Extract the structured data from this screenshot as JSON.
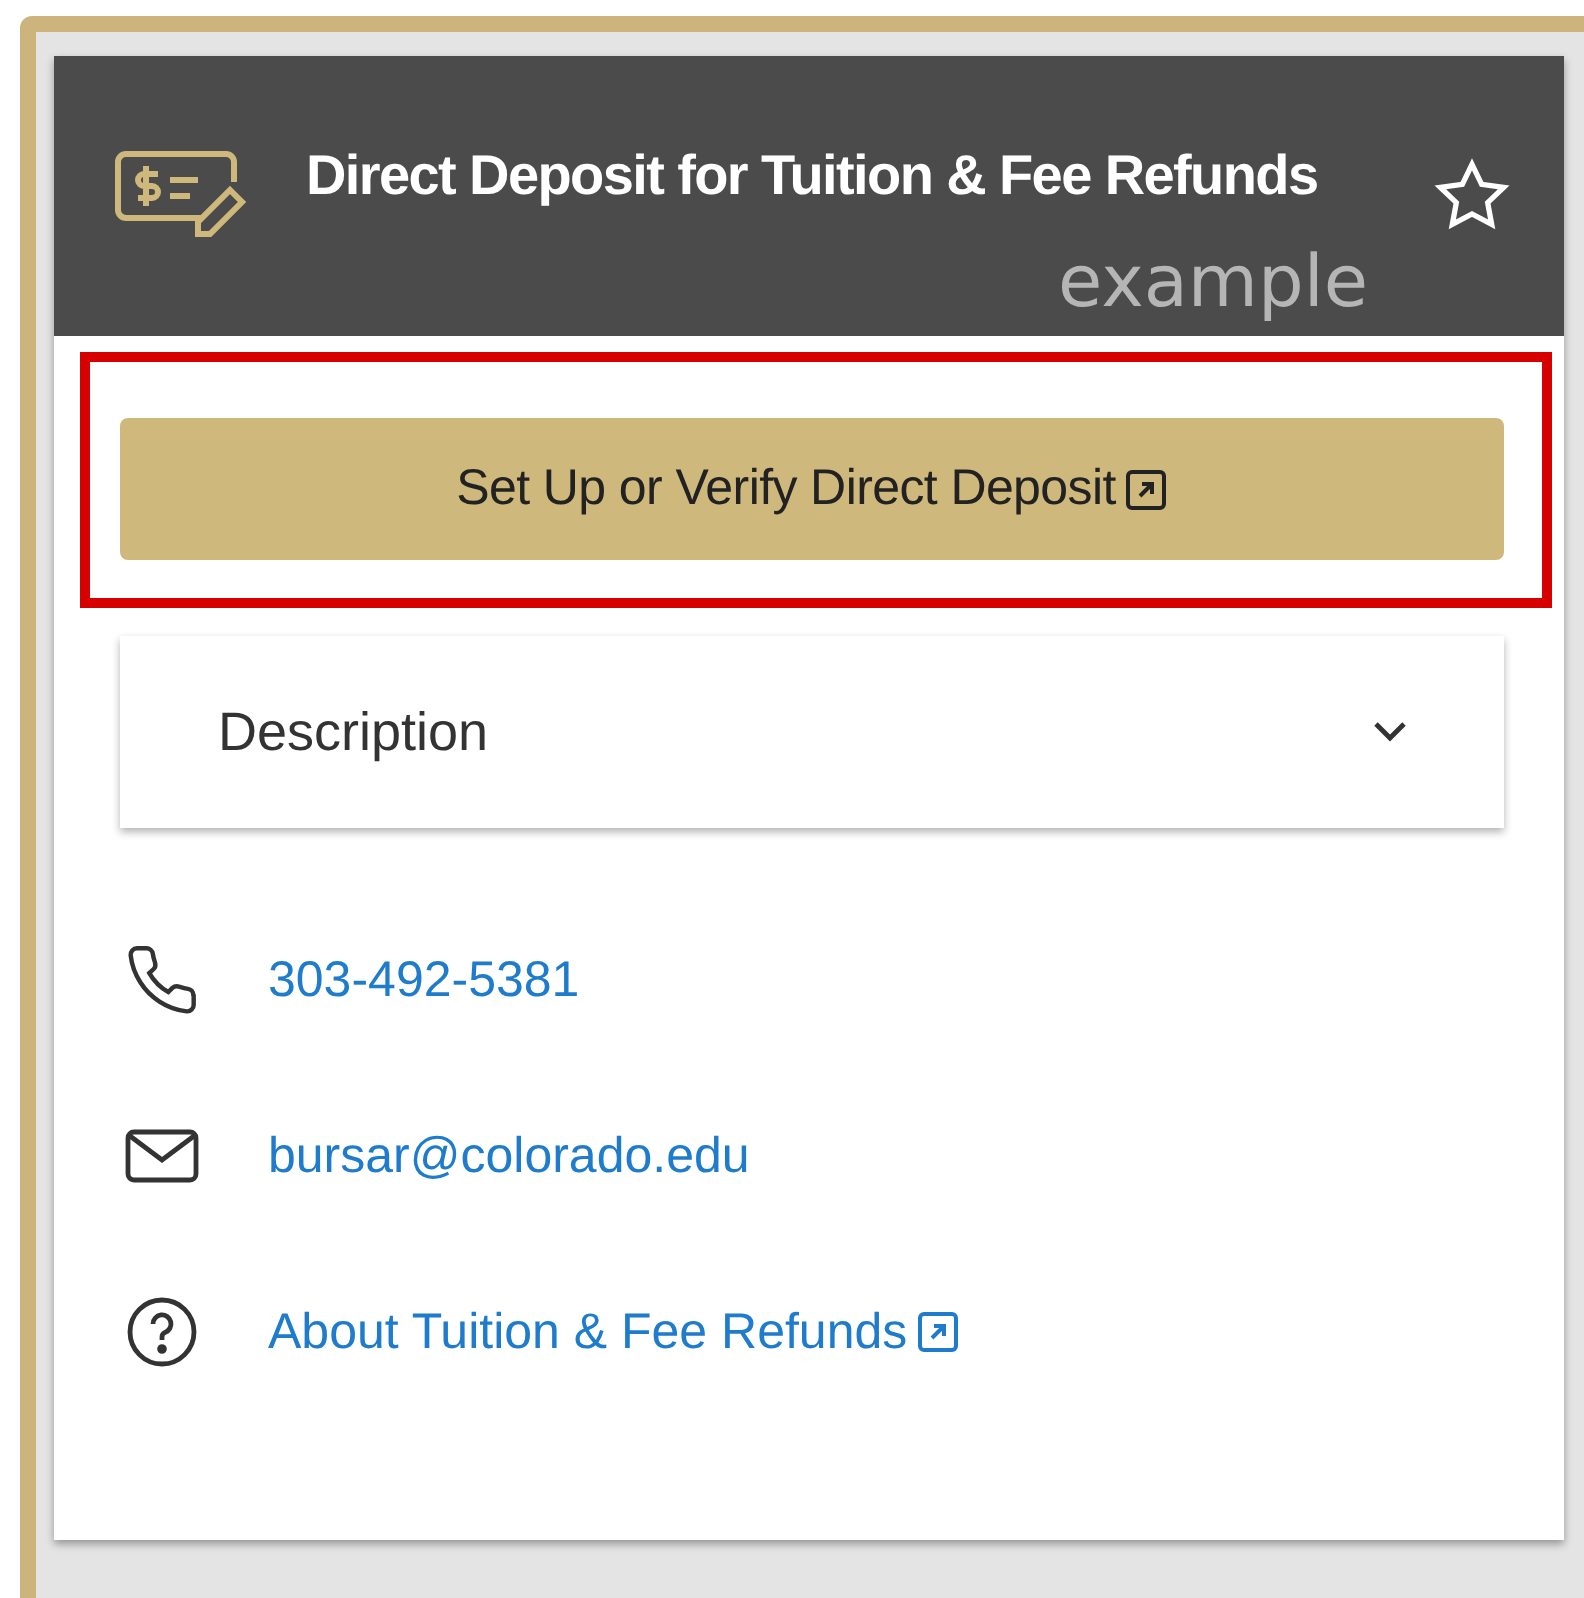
{
  "card": {
    "title": "Direct Deposit for Tuition & Fee Refunds",
    "annotation": "example",
    "favorite": false,
    "action": {
      "label": "Set Up or Verify Direct Deposit",
      "external": true,
      "highlighted": true
    },
    "description": {
      "label": "Description",
      "expanded": false
    },
    "contacts": [
      {
        "kind": "phone",
        "text": "303-492-5381",
        "external": false
      },
      {
        "kind": "email",
        "text": "bursar@colorado.edu",
        "external": false
      },
      {
        "kind": "help",
        "text": "About Tuition & Fee Refunds",
        "external": true
      }
    ]
  }
}
